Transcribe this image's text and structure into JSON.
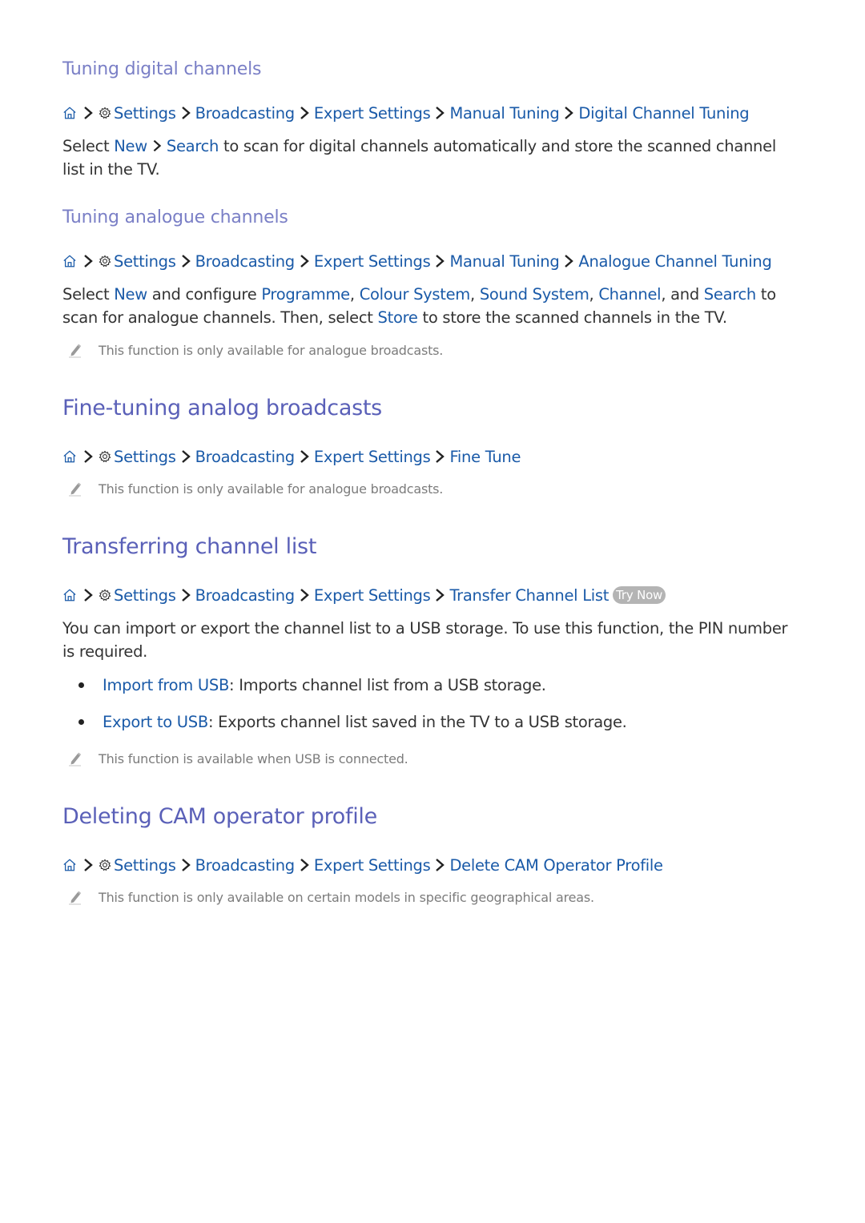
{
  "colors": {
    "subheading": "#7a7fc6",
    "heading": "#5a60b8",
    "link": "#1a5aa8",
    "body_text": "#333333",
    "note_text": "#7c7c7c",
    "badge_bg": "#b4b4b4"
  },
  "icons": {
    "home": "home-icon",
    "settings": "gear-icon",
    "separator": "chevron-right-icon",
    "note": "pencil-icon",
    "bullet": "bullet-dot"
  },
  "sections": {
    "digital": {
      "title": "Tuning digital channels",
      "path": [
        "Settings",
        "Broadcasting",
        "Expert Settings",
        "Manual Tuning",
        "Digital Channel Tuning"
      ],
      "body": {
        "t1": "Select ",
        "l1": "New",
        "l2": "Search",
        "t2": " to scan for digital channels automatically and store the scanned channel list in the TV."
      }
    },
    "analogue": {
      "title": "Tuning analogue channels",
      "path": [
        "Settings",
        "Broadcasting",
        "Expert Settings",
        "Manual Tuning",
        "Analogue Channel Tuning"
      ],
      "body": {
        "t1": "Select ",
        "l1": "New",
        "t2": " and configure ",
        "l2": "Programme",
        "t3": ", ",
        "l3": "Colour System",
        "t4": ", ",
        "l4": "Sound System",
        "t5": ", ",
        "l5": "Channel",
        "t6": ", and ",
        "l6": "Search",
        "t7": " to scan for analogue channels. Then, select ",
        "l7": "Store",
        "t8": " to store the scanned channels in the TV."
      },
      "note": "This function is only available for analogue broadcasts."
    },
    "finetune": {
      "title": "Fine-tuning analog broadcasts",
      "path": [
        "Settings",
        "Broadcasting",
        "Expert Settings",
        "Fine Tune"
      ],
      "note": "This function is only available for analogue broadcasts."
    },
    "transfer": {
      "title": "Transferring channel list",
      "path": [
        "Settings",
        "Broadcasting",
        "Expert Settings",
        "Transfer Channel List"
      ],
      "badge": "Try Now",
      "body": "You can import or export the channel list to a USB storage. To use this function, the PIN number is required.",
      "bullets": [
        {
          "link": "Import from USB",
          "text": ": Imports channel list from a USB storage."
        },
        {
          "link": "Export to USB",
          "text": ": Exports channel list saved in the TV to a USB storage."
        }
      ],
      "note": "This function is available when USB is connected."
    },
    "cam": {
      "title": "Deleting CAM operator profile",
      "path": [
        "Settings",
        "Broadcasting",
        "Expert Settings",
        "Delete CAM Operator Profile"
      ],
      "note": "This function is only available on certain models in specific geographical areas."
    }
  }
}
